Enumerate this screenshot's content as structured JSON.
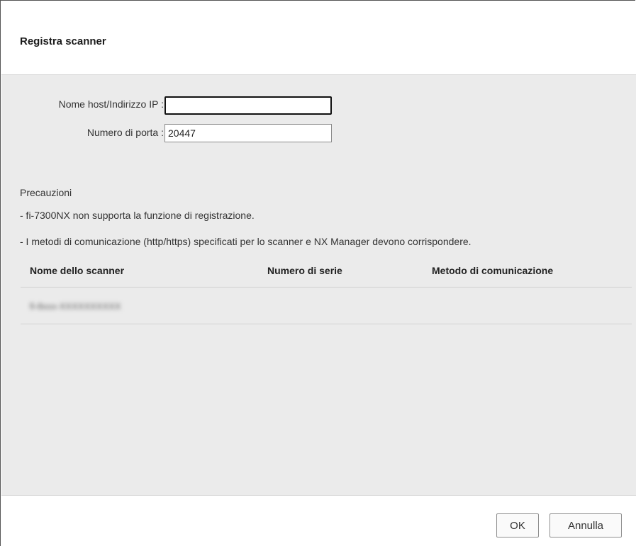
{
  "dialog": {
    "title": "Registra scanner"
  },
  "form": {
    "host_label": "Nome host/Indirizzo IP :",
    "host_value": "",
    "port_label": "Numero di porta :",
    "port_value": "20447"
  },
  "precautions": {
    "title": "Precauzioni",
    "notes": [
      "- fi-7300NX non supporta la funzione di registrazione.",
      "- I metodi di comunicazione (http/https) specificati per lo scanner e NX Manager devono corrispondere."
    ]
  },
  "table": {
    "columns": [
      "Nome dello scanner",
      "Numero di serie",
      "Metodo di comunicazione"
    ],
    "rows": [
      {
        "name": "fi-8xxx-XXXXXXXXXX",
        "serial": "",
        "method": ""
      }
    ]
  },
  "buttons": {
    "ok": "OK",
    "cancel": "Annulla"
  }
}
